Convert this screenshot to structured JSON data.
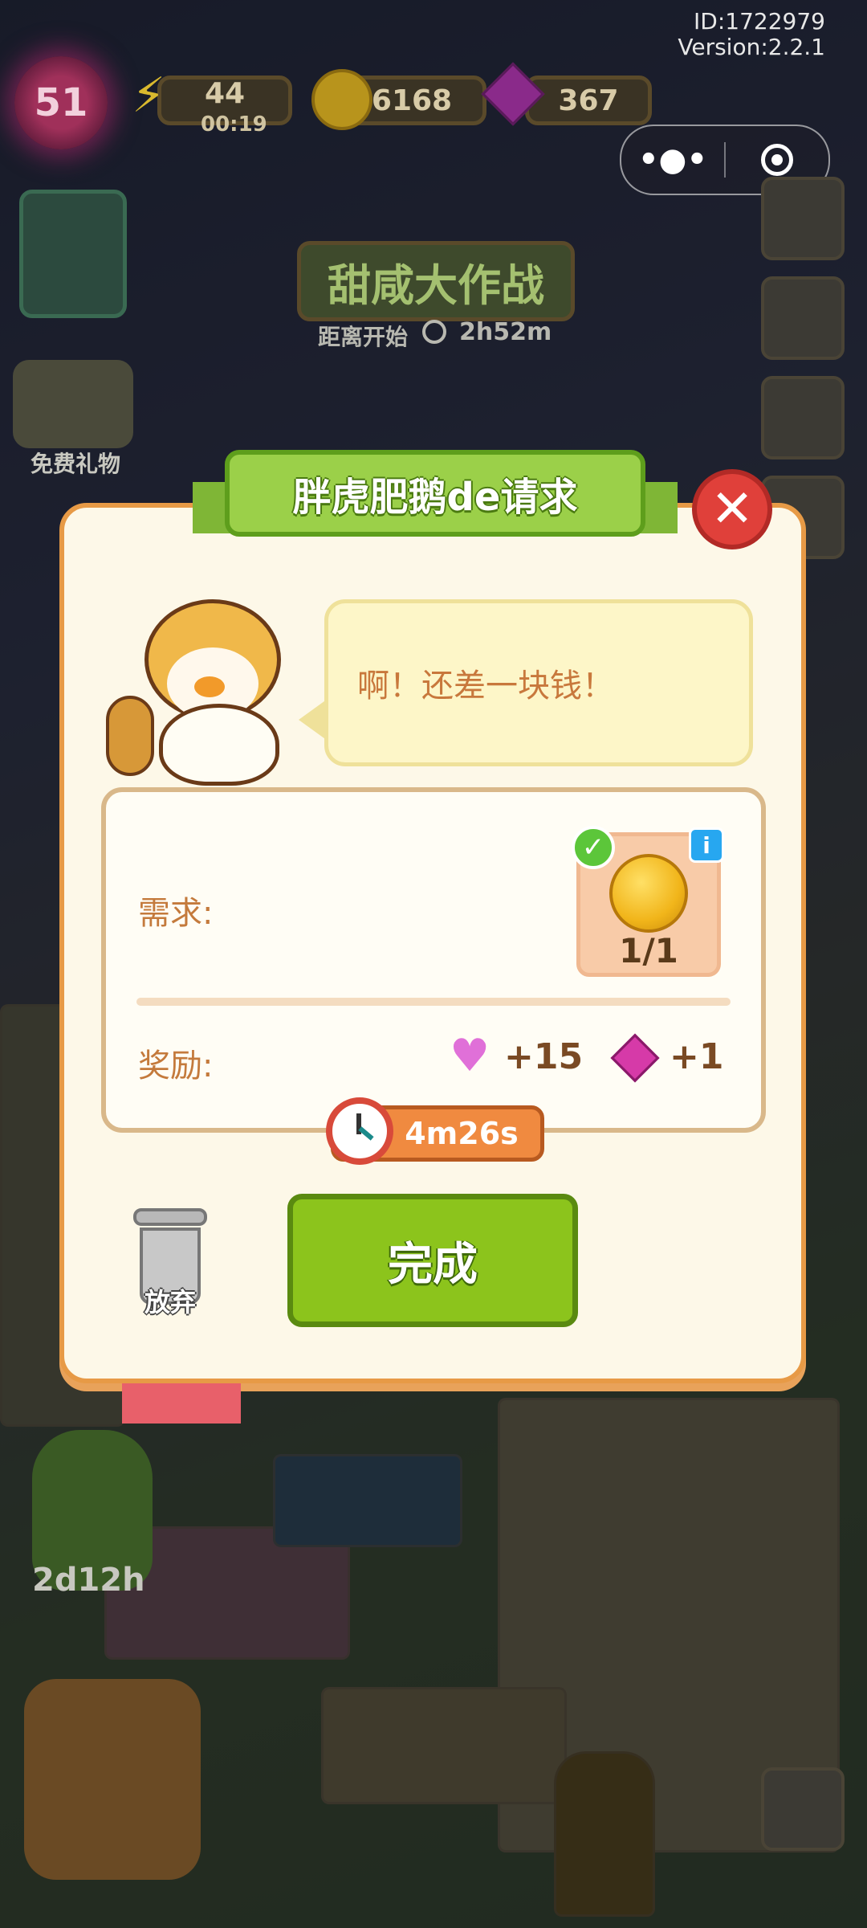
{
  "header": {
    "id_text": "ID:1722979",
    "version_text": "Version:2.2.1"
  },
  "hud": {
    "level": "51",
    "energy": "44",
    "energy_timer": "00:19",
    "coins": "6168",
    "gems": "367"
  },
  "event": {
    "title": "甜咸大作战",
    "countdown_label": "距离开始",
    "countdown": "2h52m"
  },
  "left_panel": {
    "free_gift_label": "免费礼物",
    "boost_timer": "2d12h"
  },
  "dialog": {
    "title": "胖虎肥鹅de请求",
    "speech": "啊！还差一块钱！",
    "requirement_label": "需求:",
    "requirement_item": "coin",
    "requirement_progress": "1/1",
    "reward_label": "奖励:",
    "reward_heart": "+15",
    "reward_gem": "+1",
    "timer": "4m26s",
    "complete_label": "完成",
    "give_up_label": "放弃"
  },
  "colors": {
    "dialog_border": "#e79a46",
    "title_ribbon": "#9bd049",
    "complete_button": "#8cc41c",
    "close_button": "#e0403a",
    "label_text": "#c47a3c"
  }
}
